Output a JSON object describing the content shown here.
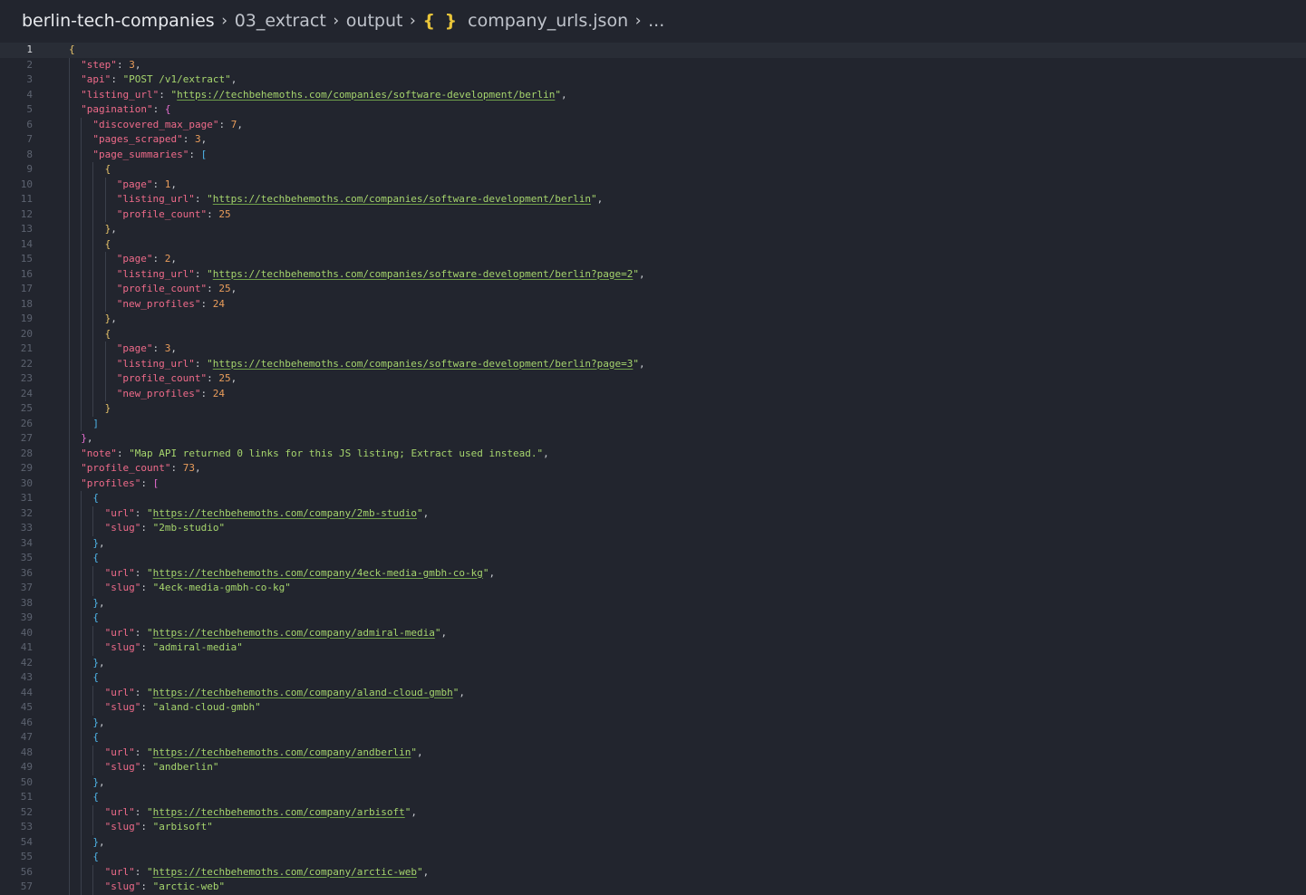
{
  "breadcrumb": {
    "root": "berlin-tech-companies",
    "folder1": "03_extract",
    "folder2": "output",
    "file_icon": "{ }",
    "file": "company_urls.json",
    "more": "..."
  },
  "editor": {
    "current_line": 1,
    "lines": [
      {
        "n": 1,
        "indent": 0,
        "t": [
          [
            "brace",
            "{"
          ]
        ]
      },
      {
        "n": 2,
        "indent": 1,
        "t": [
          [
            "key",
            "\"step\""
          ],
          [
            "pun",
            ": "
          ],
          [
            "num",
            "3"
          ],
          [
            "pun",
            ","
          ]
        ]
      },
      {
        "n": 3,
        "indent": 1,
        "t": [
          [
            "key",
            "\"api\""
          ],
          [
            "pun",
            ": "
          ],
          [
            "str",
            "\"POST /v1/extract\""
          ],
          [
            "pun",
            ","
          ]
        ]
      },
      {
        "n": 4,
        "indent": 1,
        "t": [
          [
            "key",
            "\"listing_url\""
          ],
          [
            "pun",
            ": "
          ],
          [
            "str",
            "\""
          ],
          [
            "link",
            "https://techbehemoths.com/companies/software-development/berlin"
          ],
          [
            "str",
            "\""
          ],
          [
            "pun",
            ","
          ]
        ]
      },
      {
        "n": 5,
        "indent": 1,
        "t": [
          [
            "key",
            "\"pagination\""
          ],
          [
            "pun",
            ": "
          ],
          [
            "sq",
            "{"
          ]
        ]
      },
      {
        "n": 6,
        "indent": 2,
        "t": [
          [
            "key",
            "\"discovered_max_page\""
          ],
          [
            "pun",
            ": "
          ],
          [
            "num",
            "7"
          ],
          [
            "pun",
            ","
          ]
        ]
      },
      {
        "n": 7,
        "indent": 2,
        "t": [
          [
            "key",
            "\"pages_scraped\""
          ],
          [
            "pun",
            ": "
          ],
          [
            "num",
            "3"
          ],
          [
            "pun",
            ","
          ]
        ]
      },
      {
        "n": 8,
        "indent": 2,
        "t": [
          [
            "key",
            "\"page_summaries\""
          ],
          [
            "pun",
            ": "
          ],
          [
            "sq2",
            "["
          ]
        ]
      },
      {
        "n": 9,
        "indent": 3,
        "t": [
          [
            "brace",
            "{"
          ]
        ]
      },
      {
        "n": 10,
        "indent": 4,
        "t": [
          [
            "key",
            "\"page\""
          ],
          [
            "pun",
            ": "
          ],
          [
            "num",
            "1"
          ],
          [
            "pun",
            ","
          ]
        ]
      },
      {
        "n": 11,
        "indent": 4,
        "t": [
          [
            "key",
            "\"listing_url\""
          ],
          [
            "pun",
            ": "
          ],
          [
            "str",
            "\""
          ],
          [
            "link",
            "https://techbehemoths.com/companies/software-development/berlin"
          ],
          [
            "str",
            "\""
          ],
          [
            "pun",
            ","
          ]
        ]
      },
      {
        "n": 12,
        "indent": 4,
        "t": [
          [
            "key",
            "\"profile_count\""
          ],
          [
            "pun",
            ": "
          ],
          [
            "num",
            "25"
          ]
        ]
      },
      {
        "n": 13,
        "indent": 3,
        "t": [
          [
            "brace",
            "}"
          ],
          [
            "pun",
            ","
          ]
        ]
      },
      {
        "n": 14,
        "indent": 3,
        "t": [
          [
            "brace",
            "{"
          ]
        ]
      },
      {
        "n": 15,
        "indent": 4,
        "t": [
          [
            "key",
            "\"page\""
          ],
          [
            "pun",
            ": "
          ],
          [
            "num",
            "2"
          ],
          [
            "pun",
            ","
          ]
        ]
      },
      {
        "n": 16,
        "indent": 4,
        "t": [
          [
            "key",
            "\"listing_url\""
          ],
          [
            "pun",
            ": "
          ],
          [
            "str",
            "\""
          ],
          [
            "link",
            "https://techbehemoths.com/companies/software-development/berlin?page=2"
          ],
          [
            "str",
            "\""
          ],
          [
            "pun",
            ","
          ]
        ]
      },
      {
        "n": 17,
        "indent": 4,
        "t": [
          [
            "key",
            "\"profile_count\""
          ],
          [
            "pun",
            ": "
          ],
          [
            "num",
            "25"
          ],
          [
            "pun",
            ","
          ]
        ]
      },
      {
        "n": 18,
        "indent": 4,
        "t": [
          [
            "key",
            "\"new_profiles\""
          ],
          [
            "pun",
            ": "
          ],
          [
            "num",
            "24"
          ]
        ]
      },
      {
        "n": 19,
        "indent": 3,
        "t": [
          [
            "brace",
            "}"
          ],
          [
            "pun",
            ","
          ]
        ]
      },
      {
        "n": 20,
        "indent": 3,
        "t": [
          [
            "brace",
            "{"
          ]
        ]
      },
      {
        "n": 21,
        "indent": 4,
        "t": [
          [
            "key",
            "\"page\""
          ],
          [
            "pun",
            ": "
          ],
          [
            "num",
            "3"
          ],
          [
            "pun",
            ","
          ]
        ]
      },
      {
        "n": 22,
        "indent": 4,
        "t": [
          [
            "key",
            "\"listing_url\""
          ],
          [
            "pun",
            ": "
          ],
          [
            "str",
            "\""
          ],
          [
            "link",
            "https://techbehemoths.com/companies/software-development/berlin?page=3"
          ],
          [
            "str",
            "\""
          ],
          [
            "pun",
            ","
          ]
        ]
      },
      {
        "n": 23,
        "indent": 4,
        "t": [
          [
            "key",
            "\"profile_count\""
          ],
          [
            "pun",
            ": "
          ],
          [
            "num",
            "25"
          ],
          [
            "pun",
            ","
          ]
        ]
      },
      {
        "n": 24,
        "indent": 4,
        "t": [
          [
            "key",
            "\"new_profiles\""
          ],
          [
            "pun",
            ": "
          ],
          [
            "num",
            "24"
          ]
        ]
      },
      {
        "n": 25,
        "indent": 3,
        "t": [
          [
            "brace",
            "}"
          ]
        ]
      },
      {
        "n": 26,
        "indent": 2,
        "t": [
          [
            "sq2",
            "]"
          ]
        ]
      },
      {
        "n": 27,
        "indent": 1,
        "t": [
          [
            "sq",
            "}"
          ],
          [
            "pun",
            ","
          ]
        ]
      },
      {
        "n": 28,
        "indent": 1,
        "t": [
          [
            "key",
            "\"note\""
          ],
          [
            "pun",
            ": "
          ],
          [
            "str",
            "\"Map API returned 0 links for this JS listing; Extract used instead.\""
          ],
          [
            "pun",
            ","
          ]
        ]
      },
      {
        "n": 29,
        "indent": 1,
        "t": [
          [
            "key",
            "\"profile_count\""
          ],
          [
            "pun",
            ": "
          ],
          [
            "num",
            "73"
          ],
          [
            "pun",
            ","
          ]
        ]
      },
      {
        "n": 30,
        "indent": 1,
        "t": [
          [
            "key",
            "\"profiles\""
          ],
          [
            "pun",
            ": "
          ],
          [
            "sq",
            "["
          ]
        ]
      },
      {
        "n": 31,
        "indent": 2,
        "t": [
          [
            "sq2",
            "{"
          ]
        ]
      },
      {
        "n": 32,
        "indent": 3,
        "t": [
          [
            "key",
            "\"url\""
          ],
          [
            "pun",
            ": "
          ],
          [
            "str",
            "\""
          ],
          [
            "link",
            "https://techbehemoths.com/company/2mb-studio"
          ],
          [
            "str",
            "\""
          ],
          [
            "pun",
            ","
          ]
        ]
      },
      {
        "n": 33,
        "indent": 3,
        "t": [
          [
            "key",
            "\"slug\""
          ],
          [
            "pun",
            ": "
          ],
          [
            "str",
            "\"2mb-studio\""
          ]
        ]
      },
      {
        "n": 34,
        "indent": 2,
        "t": [
          [
            "sq2",
            "}"
          ],
          [
            "pun",
            ","
          ]
        ]
      },
      {
        "n": 35,
        "indent": 2,
        "t": [
          [
            "sq2",
            "{"
          ]
        ]
      },
      {
        "n": 36,
        "indent": 3,
        "t": [
          [
            "key",
            "\"url\""
          ],
          [
            "pun",
            ": "
          ],
          [
            "str",
            "\""
          ],
          [
            "link",
            "https://techbehemoths.com/company/4eck-media-gmbh-co-kg"
          ],
          [
            "str",
            "\""
          ],
          [
            "pun",
            ","
          ]
        ]
      },
      {
        "n": 37,
        "indent": 3,
        "t": [
          [
            "key",
            "\"slug\""
          ],
          [
            "pun",
            ": "
          ],
          [
            "str",
            "\"4eck-media-gmbh-co-kg\""
          ]
        ]
      },
      {
        "n": 38,
        "indent": 2,
        "t": [
          [
            "sq2",
            "}"
          ],
          [
            "pun",
            ","
          ]
        ]
      },
      {
        "n": 39,
        "indent": 2,
        "t": [
          [
            "sq2",
            "{"
          ]
        ]
      },
      {
        "n": 40,
        "indent": 3,
        "t": [
          [
            "key",
            "\"url\""
          ],
          [
            "pun",
            ": "
          ],
          [
            "str",
            "\""
          ],
          [
            "link",
            "https://techbehemoths.com/company/admiral-media"
          ],
          [
            "str",
            "\""
          ],
          [
            "pun",
            ","
          ]
        ]
      },
      {
        "n": 41,
        "indent": 3,
        "t": [
          [
            "key",
            "\"slug\""
          ],
          [
            "pun",
            ": "
          ],
          [
            "str",
            "\"admiral-media\""
          ]
        ]
      },
      {
        "n": 42,
        "indent": 2,
        "t": [
          [
            "sq2",
            "}"
          ],
          [
            "pun",
            ","
          ]
        ]
      },
      {
        "n": 43,
        "indent": 2,
        "t": [
          [
            "sq2",
            "{"
          ]
        ]
      },
      {
        "n": 44,
        "indent": 3,
        "t": [
          [
            "key",
            "\"url\""
          ],
          [
            "pun",
            ": "
          ],
          [
            "str",
            "\""
          ],
          [
            "link",
            "https://techbehemoths.com/company/aland-cloud-gmbh"
          ],
          [
            "str",
            "\""
          ],
          [
            "pun",
            ","
          ]
        ]
      },
      {
        "n": 45,
        "indent": 3,
        "t": [
          [
            "key",
            "\"slug\""
          ],
          [
            "pun",
            ": "
          ],
          [
            "str",
            "\"aland-cloud-gmbh\""
          ]
        ]
      },
      {
        "n": 46,
        "indent": 2,
        "t": [
          [
            "sq2",
            "}"
          ],
          [
            "pun",
            ","
          ]
        ]
      },
      {
        "n": 47,
        "indent": 2,
        "t": [
          [
            "sq2",
            "{"
          ]
        ]
      },
      {
        "n": 48,
        "indent": 3,
        "t": [
          [
            "key",
            "\"url\""
          ],
          [
            "pun",
            ": "
          ],
          [
            "str",
            "\""
          ],
          [
            "link",
            "https://techbehemoths.com/company/andberlin"
          ],
          [
            "str",
            "\""
          ],
          [
            "pun",
            ","
          ]
        ]
      },
      {
        "n": 49,
        "indent": 3,
        "t": [
          [
            "key",
            "\"slug\""
          ],
          [
            "pun",
            ": "
          ],
          [
            "str",
            "\"andberlin\""
          ]
        ]
      },
      {
        "n": 50,
        "indent": 2,
        "t": [
          [
            "sq2",
            "}"
          ],
          [
            "pun",
            ","
          ]
        ]
      },
      {
        "n": 51,
        "indent": 2,
        "t": [
          [
            "sq2",
            "{"
          ]
        ]
      },
      {
        "n": 52,
        "indent": 3,
        "t": [
          [
            "key",
            "\"url\""
          ],
          [
            "pun",
            ": "
          ],
          [
            "str",
            "\""
          ],
          [
            "link",
            "https://techbehemoths.com/company/arbisoft"
          ],
          [
            "str",
            "\""
          ],
          [
            "pun",
            ","
          ]
        ]
      },
      {
        "n": 53,
        "indent": 3,
        "t": [
          [
            "key",
            "\"slug\""
          ],
          [
            "pun",
            ": "
          ],
          [
            "str",
            "\"arbisoft\""
          ]
        ]
      },
      {
        "n": 54,
        "indent": 2,
        "t": [
          [
            "sq2",
            "}"
          ],
          [
            "pun",
            ","
          ]
        ]
      },
      {
        "n": 55,
        "indent": 2,
        "t": [
          [
            "sq2",
            "{"
          ]
        ]
      },
      {
        "n": 56,
        "indent": 3,
        "t": [
          [
            "key",
            "\"url\""
          ],
          [
            "pun",
            ": "
          ],
          [
            "str",
            "\""
          ],
          [
            "link",
            "https://techbehemoths.com/company/arctic-web"
          ],
          [
            "str",
            "\""
          ],
          [
            "pun",
            ","
          ]
        ]
      },
      {
        "n": 57,
        "indent": 3,
        "t": [
          [
            "key",
            "\"slug\""
          ],
          [
            "pun",
            ": "
          ],
          [
            "str",
            "\"arctic-web\""
          ]
        ]
      }
    ]
  }
}
